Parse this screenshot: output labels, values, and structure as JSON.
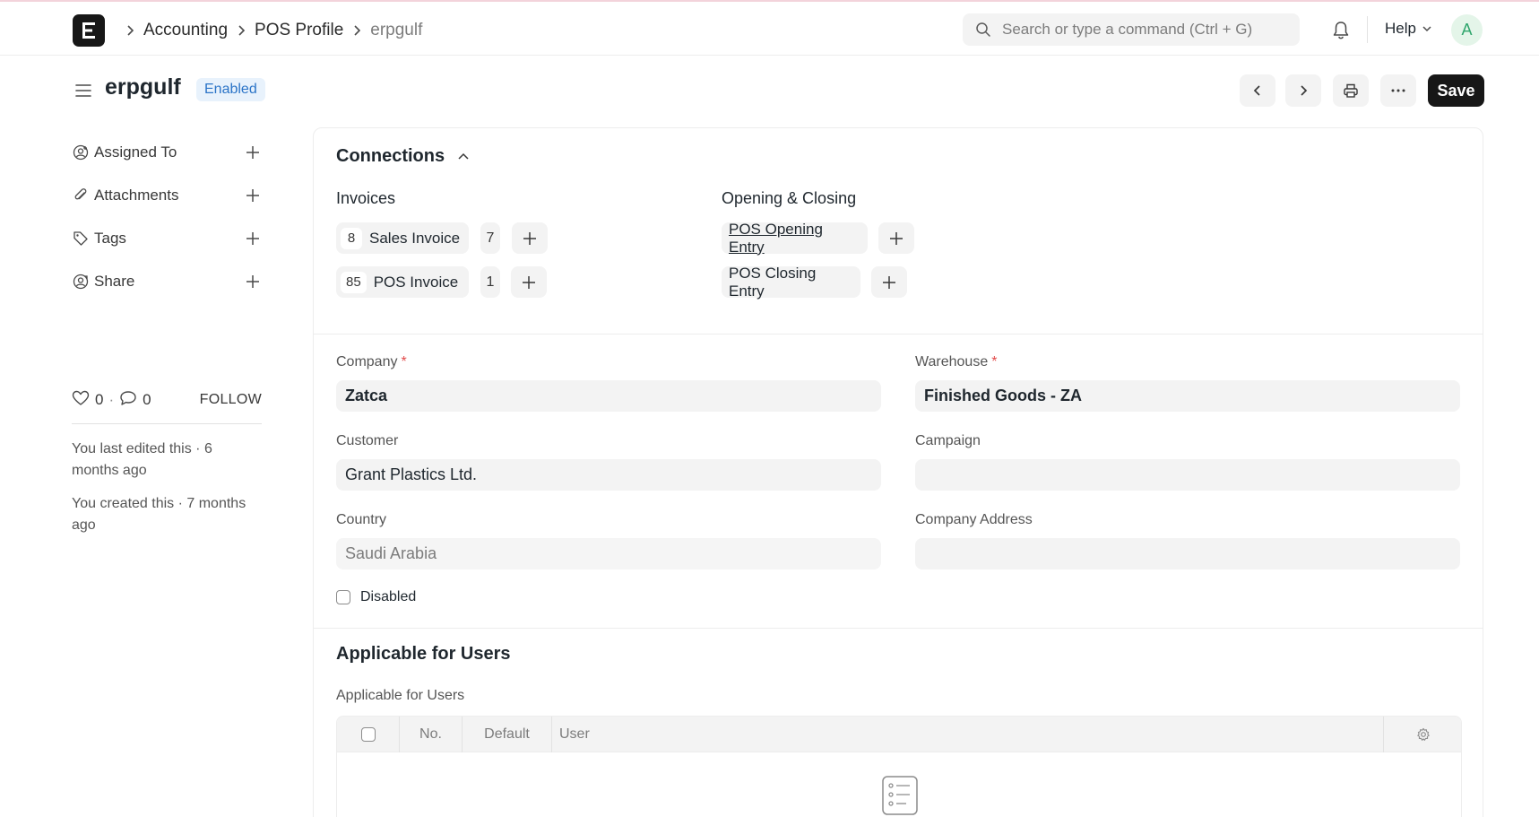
{
  "breadcrumbs": [
    "Accounting",
    "POS Profile",
    "erpgulf"
  ],
  "search": {
    "placeholder": "Search or type a command (Ctrl + G)"
  },
  "navbar": {
    "help_label": "Help",
    "avatar_initial": "A"
  },
  "doc": {
    "title": "erpgulf",
    "status": "Enabled",
    "save_label": "Save"
  },
  "sidebar": {
    "items": [
      {
        "label": "Assigned To",
        "icon": "assign-user-icon"
      },
      {
        "label": "Attachments",
        "icon": "paperclip-icon"
      },
      {
        "label": "Tags",
        "icon": "tag-icon"
      },
      {
        "label": "Share",
        "icon": "share-user-icon"
      }
    ],
    "likes": "0",
    "comments": "0",
    "dot": "·",
    "follow_label": "FOLLOW",
    "last_edited": "You last edited this · 6 months ago",
    "created": "You created this · 7 months ago"
  },
  "connections": {
    "title": "Connections",
    "groups": [
      {
        "title": "Invoices",
        "links": [
          {
            "count": "8",
            "label": "Sales Invoice",
            "open": "7"
          },
          {
            "count": "85",
            "label": "POS Invoice",
            "open": "1"
          }
        ]
      },
      {
        "title": "Opening & Closing",
        "links": [
          {
            "label": "POS Opening Entry"
          },
          {
            "label": "POS Closing Entry"
          }
        ]
      }
    ]
  },
  "fields": {
    "company": {
      "label": "Company",
      "value": "Zatca",
      "required": "*"
    },
    "warehouse": {
      "label": "Warehouse",
      "value": "Finished Goods - ZA",
      "required": "*"
    },
    "customer": {
      "label": "Customer",
      "value": "Grant Plastics Ltd."
    },
    "campaign": {
      "label": "Campaign",
      "value": ""
    },
    "country": {
      "label": "Country",
      "value": "Saudi Arabia"
    },
    "company_address": {
      "label": "Company Address",
      "value": ""
    },
    "disabled": {
      "label": "Disabled",
      "checked": false
    }
  },
  "users_section": {
    "title": "Applicable for Users",
    "table_label": "Applicable for Users",
    "columns": [
      "No.",
      "Default",
      "User"
    ]
  },
  "colors": {
    "primary_button": "#171717",
    "badge_bg": "#e8f2fc",
    "badge_text": "#2b74c7",
    "required": "#e24c4c",
    "avatar_bg": "#e4f5e9",
    "avatar_text": "#30a66d"
  }
}
